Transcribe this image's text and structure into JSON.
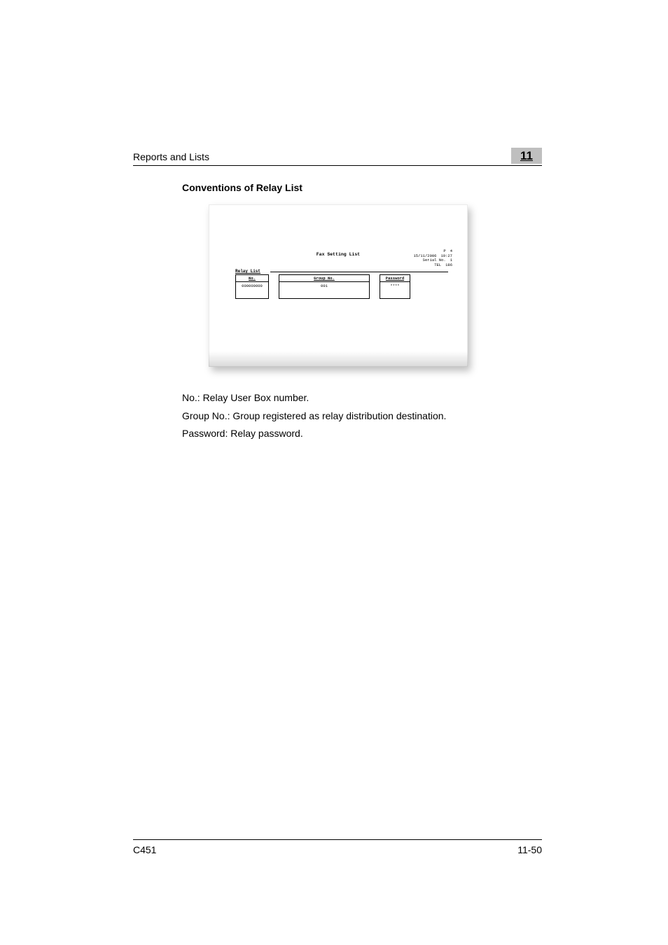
{
  "header": {
    "running_head": "Reports and Lists",
    "chapter_number": "11"
  },
  "subheading": "Conventions of Relay List",
  "fax": {
    "title": "Fax Setting List",
    "meta": {
      "p_label": "P",
      "p_value": "4",
      "date": "15/11/2006",
      "time": "19:27",
      "serial_label": "Serial No.",
      "serial_value": "1",
      "tel_label": "TEL",
      "tel_value": "186"
    },
    "section_label": "Relay List",
    "columns": {
      "no": "No.",
      "group": "Group No.",
      "password": "Password"
    },
    "row": {
      "no": "000000000",
      "group": "001",
      "password": "****"
    }
  },
  "body": {
    "p1": "No.: Relay User Box number.",
    "p2": "Group No.: Group registered as relay distribution destination.",
    "p3": "Password: Relay password."
  },
  "footer": {
    "model": "C451",
    "page": "11-50"
  }
}
